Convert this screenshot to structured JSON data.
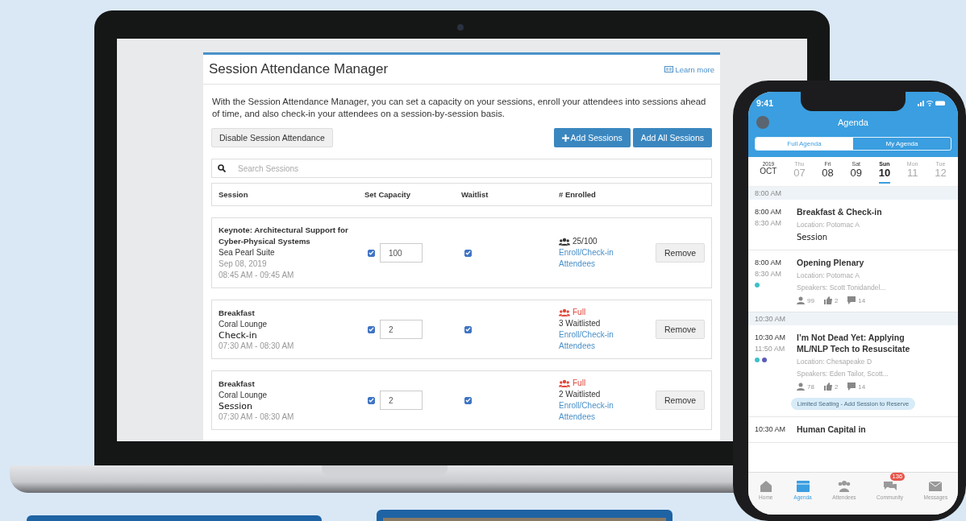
{
  "manager": {
    "title": "Session Attendance Manager",
    "learn_more": "Learn more",
    "description": "With the Session Attendance Manager, you can set a capacity on your sessions, enroll your attendees into sessions ahead of time, and also check-in your attendees on a session-by-session basis.",
    "disable_button": "Disable Session Attendance",
    "add_button": "Add Sessions",
    "add_all_button": "Add All Sessions",
    "search": {
      "placeholder": "Search Sessions"
    },
    "columns": [
      "Session",
      "Set Capacity",
      "Waitlist",
      "# Enrolled"
    ],
    "sessions": [
      {
        "title": "Keynote: Architectural Support for Cyber-Physical Systems",
        "location": "Sea Pearl Suite",
        "date": "Sep 08, 2019",
        "time": "08:45 AM - 09:45 AM",
        "capacity_checked": true,
        "capacity": "100",
        "waitlist_checked": true,
        "status": {
          "kind": "count",
          "text": "25/100"
        },
        "link": "Enroll/Check-in Attendees",
        "remove": "Remove"
      },
      {
        "title": "Breakfast",
        "location": "Coral Lounge",
        "overlay_label": "Check-in",
        "time": "07:30 AM - 08:30 AM",
        "capacity_checked": true,
        "capacity": "2",
        "waitlist_checked": true,
        "status": {
          "kind": "full",
          "text": "Full"
        },
        "waitlisted": "3 Waitlisted",
        "link": "Enroll/Check-in Attendees",
        "remove": "Remove"
      },
      {
        "title": "Breakfast",
        "location": "Coral Lounge",
        "overlay_label": "Session",
        "time": "07:30 AM - 08:30 AM",
        "capacity_checked": true,
        "capacity": "2",
        "waitlist_checked": true,
        "status": {
          "kind": "full",
          "text": "Full"
        },
        "waitlisted": "2 Waitlisted",
        "link": "Enroll/Check-in Attendees",
        "remove": "Remove"
      }
    ]
  },
  "phone": {
    "time": "9:41",
    "title": "Agenda",
    "tabs": [
      {
        "label": "Full Agenda",
        "selected": true
      },
      {
        "label": "My Agenda",
        "selected": false
      }
    ],
    "year": "2019",
    "month": "OCT",
    "days": [
      {
        "weekday": "Thu",
        "day": "07",
        "muted": true,
        "selected": false
      },
      {
        "weekday": "Fri",
        "day": "08",
        "muted": false,
        "selected": false
      },
      {
        "weekday": "Sat",
        "day": "09",
        "muted": false,
        "selected": false
      },
      {
        "weekday": "Sun",
        "day": "10",
        "muted": false,
        "selected": true
      },
      {
        "weekday": "Mon",
        "day": "11",
        "muted": true,
        "selected": false
      },
      {
        "weekday": "Tue",
        "day": "12",
        "muted": true,
        "selected": false
      }
    ],
    "sections": [
      {
        "header": "8:00 AM",
        "items": [
          {
            "start": "8:00 AM",
            "end": "8:30 AM",
            "title": "Breakfast & Check-in",
            "location": "Location: Potomac A",
            "overlay_label": "Session"
          },
          {
            "start": "8:00 AM",
            "end": "8:30 AM",
            "title": "Opening Plenary",
            "location": "Location: Potomac A",
            "speakers": "Speakers: Scott Tonidandel...",
            "dots": [
              {
                "color": "#3cc0c8"
              }
            ],
            "stats": [
              "99",
              "2",
              "14"
            ]
          }
        ]
      },
      {
        "header": "10:30 AM",
        "items": [
          {
            "start": "10:30 AM",
            "end": "11:50 AM",
            "title": "I’m Not Dead Yet: Applying ML/NLP Tech to Resuscitate",
            "location": "Location: Chesapeake D",
            "speakers": "Speakers: Eden Tailor, Scott...",
            "dots": [
              {
                "color": "#3cc0c8"
              },
              {
                "color": "#5b5bb8"
              }
            ],
            "stats": [
              "78",
              "2",
              "14"
            ],
            "pill": "Limited Seating - Add Session to Reserve"
          },
          {
            "start": "10:30 AM",
            "title": "Human Capital in"
          }
        ]
      }
    ],
    "nav": [
      {
        "label": "Home",
        "selected": false
      },
      {
        "label": "Agenda",
        "selected": true
      },
      {
        "label": "Attendees",
        "selected": false
      },
      {
        "label": "Community",
        "selected": false,
        "badge": "136"
      },
      {
        "label": "Messages",
        "selected": false
      }
    ]
  }
}
